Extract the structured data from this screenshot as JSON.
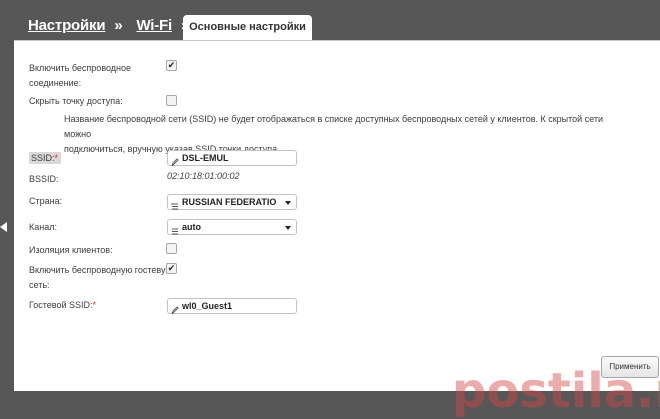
{
  "breadcrumb": {
    "item1": "Настройки",
    "sep1": "»",
    "item2": "Wi-Fi",
    "sep2": "»"
  },
  "tab": {
    "label": "Основные настройки"
  },
  "form": {
    "enable_wireless_label_line1": "Включить беспроводное",
    "enable_wireless_label_line2": "соединение:",
    "enable_wireless_checked": true,
    "hide_ap_label": "Скрыть точку доступа:",
    "hide_ap_checked": false,
    "hide_ap_note_line1": "Название беспроводной сети (SSID) не будет отображаться в списке доступных беспроводных сетей у клиентов. К скрытой сети можно",
    "hide_ap_note_line2": "подключиться, вручную указав SSID точки доступа.",
    "ssid_label": "SSID:",
    "ssid_required": "*",
    "ssid_value": "DSL-EMUL",
    "bssid_label": "BSSID:",
    "bssid_value": "02:10:18:01:00:02",
    "country_label": "Страна:",
    "country_value": "RUSSIAN FEDERATIO",
    "channel_label": "Канал:",
    "channel_value": "auto",
    "client_isolation_label": "Изоляция клиентов:",
    "client_isolation_checked": false,
    "guest_net_label_line1": "Включить беспроводную гостевую",
    "guest_net_label_line2": "сеть:",
    "guest_net_checked": true,
    "guest_ssid_label": "Гостевой SSID:",
    "guest_ssid_required": "*",
    "guest_ssid_value": "wl0_Guest1"
  },
  "apply_button": "Применить",
  "watermark": "postila.ru",
  "icons": [
    "pencil-icon",
    "list-icon",
    "dropdown-arrow-icon",
    "checkmark-icon",
    "left-arrow-icon"
  ]
}
